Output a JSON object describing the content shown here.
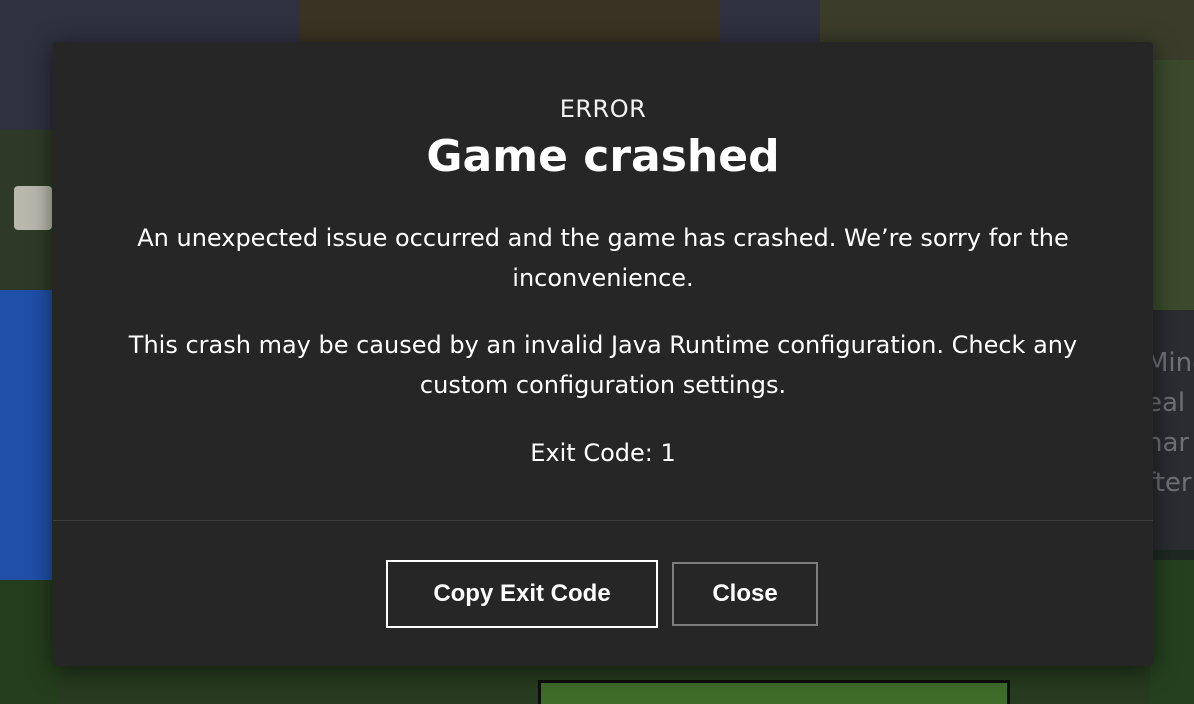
{
  "background": {
    "side_text_lines": [
      "Mine",
      "eal",
      "har",
      "fter"
    ]
  },
  "dialog": {
    "eyebrow": "ERROR",
    "title": "Game crashed",
    "message_1": "An unexpected issue occurred and the game has crashed. We’re sorry for the inconvenience.",
    "message_2": "This crash may be caused by an invalid Java Runtime configuration. Check any custom configuration settings.",
    "exit_code": "Exit Code: 1",
    "buttons": {
      "copy_label": "Copy Exit Code",
      "close_label": "Close"
    }
  },
  "colors": {
    "dialog_bg": "#262626",
    "primary_border": "#ffffff",
    "secondary_border": "#7d7d7d",
    "text": "#ffffff"
  }
}
